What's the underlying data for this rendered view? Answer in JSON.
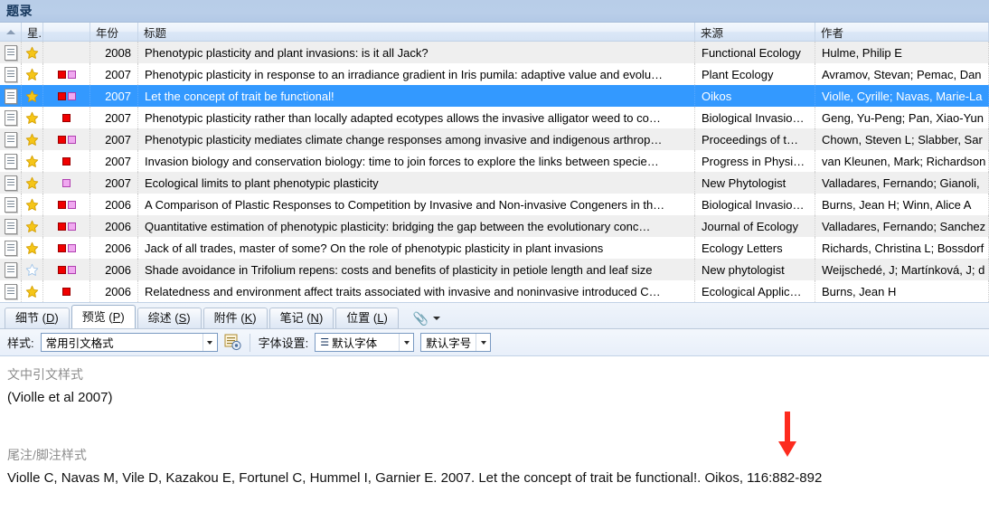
{
  "window": {
    "title": "题录"
  },
  "columns": [
    {
      "key": "doc",
      "label": "",
      "name": "column-header-doc"
    },
    {
      "key": "star",
      "label": "星...",
      "name": "column-header-star"
    },
    {
      "key": "mark",
      "label": "",
      "name": "column-header-mark"
    },
    {
      "key": "year",
      "label": "年份",
      "name": "column-header-year"
    },
    {
      "key": "title",
      "label": "标题",
      "name": "column-header-title"
    },
    {
      "key": "src",
      "label": "来源",
      "name": "column-header-source"
    },
    {
      "key": "auth",
      "label": "作者",
      "name": "column-header-author"
    }
  ],
  "rows": [
    {
      "star": "filled",
      "marks": [],
      "year": "2008",
      "title": "Phenotypic plasticity and plant invasions: is it all Jack?",
      "source": "Functional Ecology",
      "author": "Hulme, Philip E",
      "selected": false
    },
    {
      "star": "filled",
      "marks": [
        "red",
        "pink"
      ],
      "year": "2007",
      "title": "Phenotypic plasticity in response to an irradiance gradient in Iris pumila: adaptive value and evolu…",
      "source": "Plant Ecology",
      "author": "Avramov, Stevan; Pemac, Dan",
      "selected": false
    },
    {
      "star": "filled",
      "marks": [
        "red",
        "pink"
      ],
      "year": "2007",
      "title": "Let the concept of trait be functional!",
      "source": "Oikos",
      "author": "Violle, Cyrille; Navas, Marie-La",
      "selected": true
    },
    {
      "star": "filled",
      "marks": [
        "red"
      ],
      "year": "2007",
      "title": "Phenotypic plasticity rather than locally adapted ecotypes allows the invasive alligator weed to co…",
      "source": "Biological Invasio…",
      "author": "Geng, Yu-Peng; Pan, Xiao-Yun",
      "selected": false
    },
    {
      "star": "filled",
      "marks": [
        "red",
        "pink"
      ],
      "year": "2007",
      "title": "Phenotypic plasticity mediates climate change responses among invasive and indigenous arthrop…",
      "source": "Proceedings of t…",
      "author": "Chown, Steven L; Slabber, Sar",
      "selected": false
    },
    {
      "star": "filled",
      "marks": [
        "red"
      ],
      "year": "2007",
      "title": "Invasion biology and conservation biology: time to join forces to explore the links between specie…",
      "source": "Progress in Physi…",
      "author": "van Kleunen, Mark; Richardson",
      "selected": false
    },
    {
      "star": "filled",
      "marks": [
        "pink"
      ],
      "year": "2007",
      "title": "Ecological limits to plant phenotypic plasticity",
      "source": "New Phytologist",
      "author": "Valladares, Fernando; Gianoli, ",
      "selected": false
    },
    {
      "star": "filled",
      "marks": [
        "red",
        "pink"
      ],
      "year": "2006",
      "title": "A Comparison of Plastic Responses to Competition by Invasive and Non-invasive Congeners in th…",
      "source": "Biological Invasio…",
      "author": "Burns, Jean H; Winn, Alice A",
      "selected": false
    },
    {
      "star": "filled",
      "marks": [
        "red",
        "pink"
      ],
      "year": "2006",
      "title": "Quantitative estimation of phenotypic plasticity: bridging the gap between the evolutionary conc…",
      "source": "Journal of Ecology",
      "author": "Valladares, Fernando; Sanchez",
      "selected": false
    },
    {
      "star": "filled",
      "marks": [
        "red",
        "pink"
      ],
      "year": "2006",
      "title": "Jack of all trades, master of some? On the role of phenotypic plasticity in plant invasions",
      "source": "Ecology Letters",
      "author": "Richards, Christina L; Bossdorf",
      "selected": false
    },
    {
      "star": "empty",
      "marks": [
        "red",
        "pink"
      ],
      "year": "2006",
      "title": "Shade avoidance in Trifolium repens: costs and benefits of plasticity in petiole  length and leaf size",
      "source": " New phytologist",
      "author": "Weijschedé, J; Martínková, J; d",
      "selected": false
    },
    {
      "star": "filled",
      "marks": [
        "red"
      ],
      "year": "2006",
      "title": "Relatedness and environment affect traits associated with invasive and noninvasive introduced C…",
      "source": "Ecological Applic…",
      "author": "Burns, Jean H",
      "selected": false
    }
  ],
  "tabs": [
    {
      "label": "细节 (D)",
      "key": "D",
      "active": false,
      "name": "tab-details"
    },
    {
      "label": "预览 (P)",
      "key": "P",
      "active": true,
      "name": "tab-preview"
    },
    {
      "label": "综述 (S)",
      "key": "S",
      "active": false,
      "name": "tab-summary"
    },
    {
      "label": "附件 (K)",
      "key": "K",
      "active": false,
      "name": "tab-attachments"
    },
    {
      "label": "笔记 (N)",
      "key": "N",
      "active": false,
      "name": "tab-notes"
    },
    {
      "label": "位置 (L)",
      "key": "L",
      "active": false,
      "name": "tab-location"
    }
  ],
  "toolbar": {
    "style_label": "样式:",
    "style_value": "常用引文格式",
    "font_label": "字体设置:",
    "font_value": "默认字体",
    "size_value": "默认字号"
  },
  "preview": {
    "intext_label": "文中引文样式",
    "intext_value": "(Violle et al 2007)",
    "endnote_label": "尾注/脚注样式",
    "endnote_value": "Violle C, Navas M, Vile D, Kazakou E, Fortunel C, Hummel I, Garnier E. 2007. Let the concept of trait be functional!. Oikos, 116:882-892"
  },
  "colors": {
    "selection": "#3399ff",
    "title_bar": "#b8cde8",
    "marker_red": "#f00000",
    "marker_pink": "#f0a8f0",
    "star_gold": "#f5c518",
    "annotation_arrow": "#fd2b1e"
  }
}
